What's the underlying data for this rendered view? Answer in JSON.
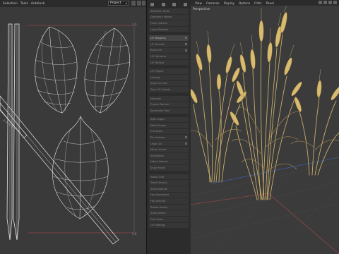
{
  "uv_editor": {
    "menu": [
      "Selection",
      "Tools",
      "Autolock"
    ],
    "projection_select": "Project",
    "corner_top_right": "1.0",
    "corner_bottom_right": "1.0"
  },
  "middle_panel": {
    "groups": [
      [
        "Selection Tools",
        "Geometry Modes",
        "Pivot Options",
        "Layer Browser"
      ],
      [
        "UV Mapping",
        "UV Transfer",
        "Relax UV",
        "UV Optimize",
        "UV Terrace"
      ],
      [
        "UV Project",
        "Unwrap",
        "Align UV Axis",
        "Pack UV Islands"
      ],
      [
        "Normals",
        "Project Normal",
        "Symmetry Tool"
      ],
      [
        "Split Edges",
        "Weld Seams",
        "Cut Seam",
        "Pin Vertices",
        "Unpin All",
        "Mirror Island",
        "Straighten",
        "Match Islands",
        "Snap Points"
      ],
      [
        "Island Grid",
        "Texel Density",
        "Stack Islands",
        "Flip Horizontal",
        "Flip Vertical",
        "Rotate Ninety",
        "Scale Island",
        "Grid Snap",
        "UV Settings"
      ]
    ]
  },
  "viewport": {
    "menu": [
      "View",
      "Cameras",
      "Display",
      "Options",
      "Filter",
      "Panel"
    ],
    "view_label": "Perspective"
  }
}
